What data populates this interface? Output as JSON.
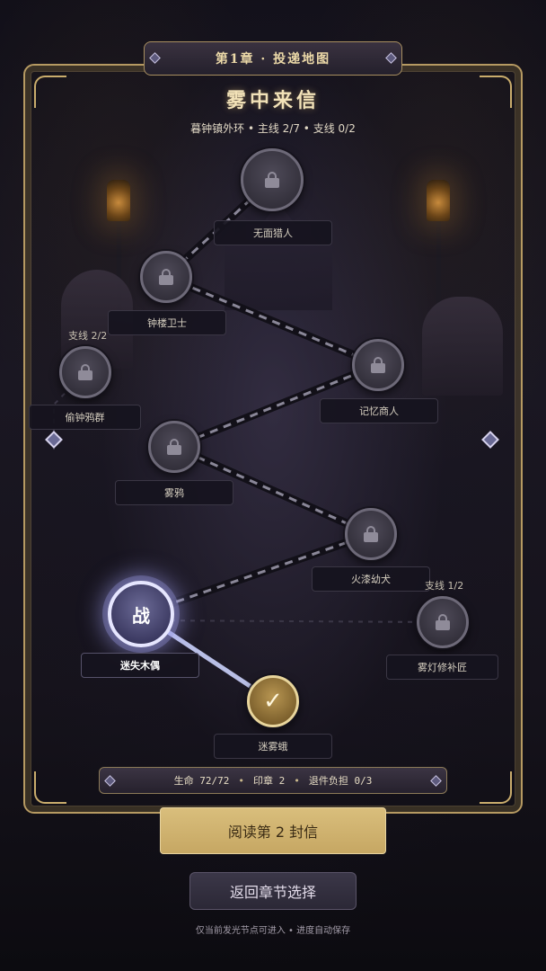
{
  "chapter_banner": "第1章 · 投递地图",
  "title": "雾中来信",
  "subtitle": "暮钟镇外环 • 主线 2/7 • 支线 0/2",
  "nodes": [
    {
      "id": "wumian",
      "label": "无面猎人",
      "state": "locked"
    },
    {
      "id": "zhonglou",
      "label": "钟楼卫士",
      "state": "locked"
    },
    {
      "id": "touzhong",
      "label": "偷钟鸦群",
      "state": "locked",
      "branch_tag": "支线 2/2"
    },
    {
      "id": "jiyi",
      "label": "记忆商人",
      "state": "locked"
    },
    {
      "id": "wuya",
      "label": "雾鸦",
      "state": "locked"
    },
    {
      "id": "huolu",
      "label": "火漆幼犬",
      "state": "locked"
    },
    {
      "id": "mishi",
      "label": "迷失木偶",
      "state": "current",
      "icon_text": "战"
    },
    {
      "id": "wudeng",
      "label": "雾灯修补匠",
      "state": "locked",
      "branch_tag": "支线 1/2"
    },
    {
      "id": "miwu",
      "label": "迷雾蛾",
      "state": "done",
      "icon_text": "✓"
    }
  ],
  "status": {
    "life": "生命 72/72",
    "seal": "印章 2",
    "burden": "退件负担 0/3",
    "separator": "•"
  },
  "read_button": "阅读第 2 封信",
  "back_button": "返回章节选择",
  "footer_hint": "仅当前发光节点可进入 • 进度自动保存",
  "colors": {
    "frame_gold": "#b69a62",
    "primary_button": "#d9be7c",
    "current_node_glow": "#aaaaff",
    "done_node": "#b89652"
  }
}
